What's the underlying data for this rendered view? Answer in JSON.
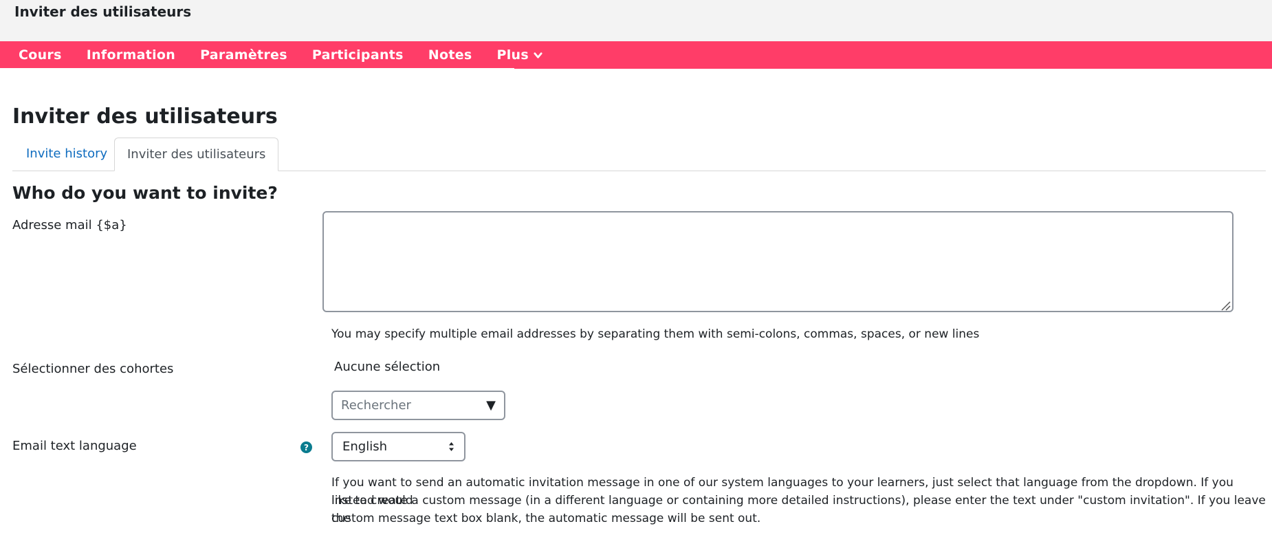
{
  "topbar": {
    "title": "Inviter des utilisateurs"
  },
  "nav": {
    "items": [
      {
        "label": "Cours"
      },
      {
        "label": "Information"
      },
      {
        "label": "Paramètres"
      },
      {
        "label": "Participants"
      },
      {
        "label": "Notes"
      },
      {
        "label": "Plus",
        "icon": "chevron-down-icon"
      }
    ],
    "color": "#ff3d68"
  },
  "page": {
    "heading": "Inviter des utilisateurs"
  },
  "tabs": [
    {
      "label": "Invite history",
      "active": false
    },
    {
      "label": "Inviter des utilisateurs",
      "active": true
    }
  ],
  "form": {
    "section_heading": "Who do you want to invite?",
    "email": {
      "label": "Adresse mail {$a}",
      "value": "",
      "help": "You may specify multiple email addresses by separating them with semi-colons, commas, spaces, or new lines"
    },
    "cohorts": {
      "label": "Sélectionner des cohortes",
      "selection": "Aucune sélection",
      "search_placeholder": "Rechercher",
      "arrow": "▼"
    },
    "language": {
      "label": "Email text language",
      "help_icon": "question-circle-icon",
      "selected": "English",
      "help_lines": [
        "If you want to send an automatic invitation message in one of our system languages to your learners, just select that language from the dropdown. If you instead would",
        "like to create a custom message (in a different language or containing more detailed instructions), please enter the text under \"custom invitation\". If you leave the",
        "custom message text box blank, the automatic message will be sent out."
      ]
    }
  }
}
